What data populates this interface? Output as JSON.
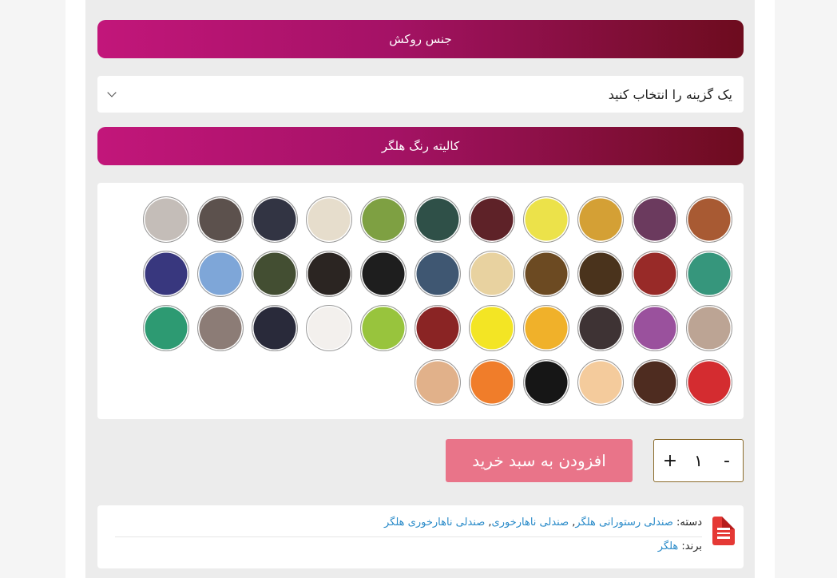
{
  "sections": {
    "upholstery_title": "جنس روکش",
    "upholstery_select_value": "یک گزینه را انتخاب کنید",
    "color_catalog_title": "کالیته رنگ هلگر"
  },
  "swatches": [
    [
      "#a85a33",
      "#6b3a5e",
      "#d4a035",
      "#ece24a",
      "#5e2228",
      "#2f5048",
      "#7ea042",
      "#e6ddcc",
      "#323443",
      "#5c514d",
      "#c4bdb8"
    ],
    [
      "#36967c",
      "#982a28",
      "#4a331c",
      "#6c4a22",
      "#e8d2a0",
      "#3f5772",
      "#1e1e1e",
      "#2b2522",
      "#434e32",
      "#7ea6d8",
      "#38377e"
    ],
    [
      "#bca494",
      "#9a519d",
      "#3e3334",
      "#f0b12a",
      "#f3e524",
      "#8a2424",
      "#98c43d",
      "#f3f0ed",
      "#292a3a",
      "#8c7c76",
      "#2d9a72"
    ],
    [
      "#d42c30",
      "#4e2c20",
      "#f4cb9c",
      "#161616",
      "#f07d2a",
      "#e1b18a"
    ]
  ],
  "cart": {
    "minus_label": "-",
    "quantity": "۱",
    "plus_label": "+",
    "add_to_cart_label": "افزودن به سبد خرید"
  },
  "meta": {
    "category_label": "دسته:",
    "categories": [
      "صندلی رستورانی هلگر",
      "صندلی ناهارخوری",
      "صندلی ناهارخوری هلگر"
    ],
    "brand_label": "برند:",
    "brand": "هلگر"
  },
  "icons": {
    "meta_icon": "document-list-icon",
    "select_chevron": "chevron-down-icon"
  },
  "colors": {
    "header_gradient_start": "#c2167a",
    "header_gradient_end": "#6d0c1e",
    "add_to_cart_bg": "#e97489",
    "link_color": "#2a8bc9"
  }
}
